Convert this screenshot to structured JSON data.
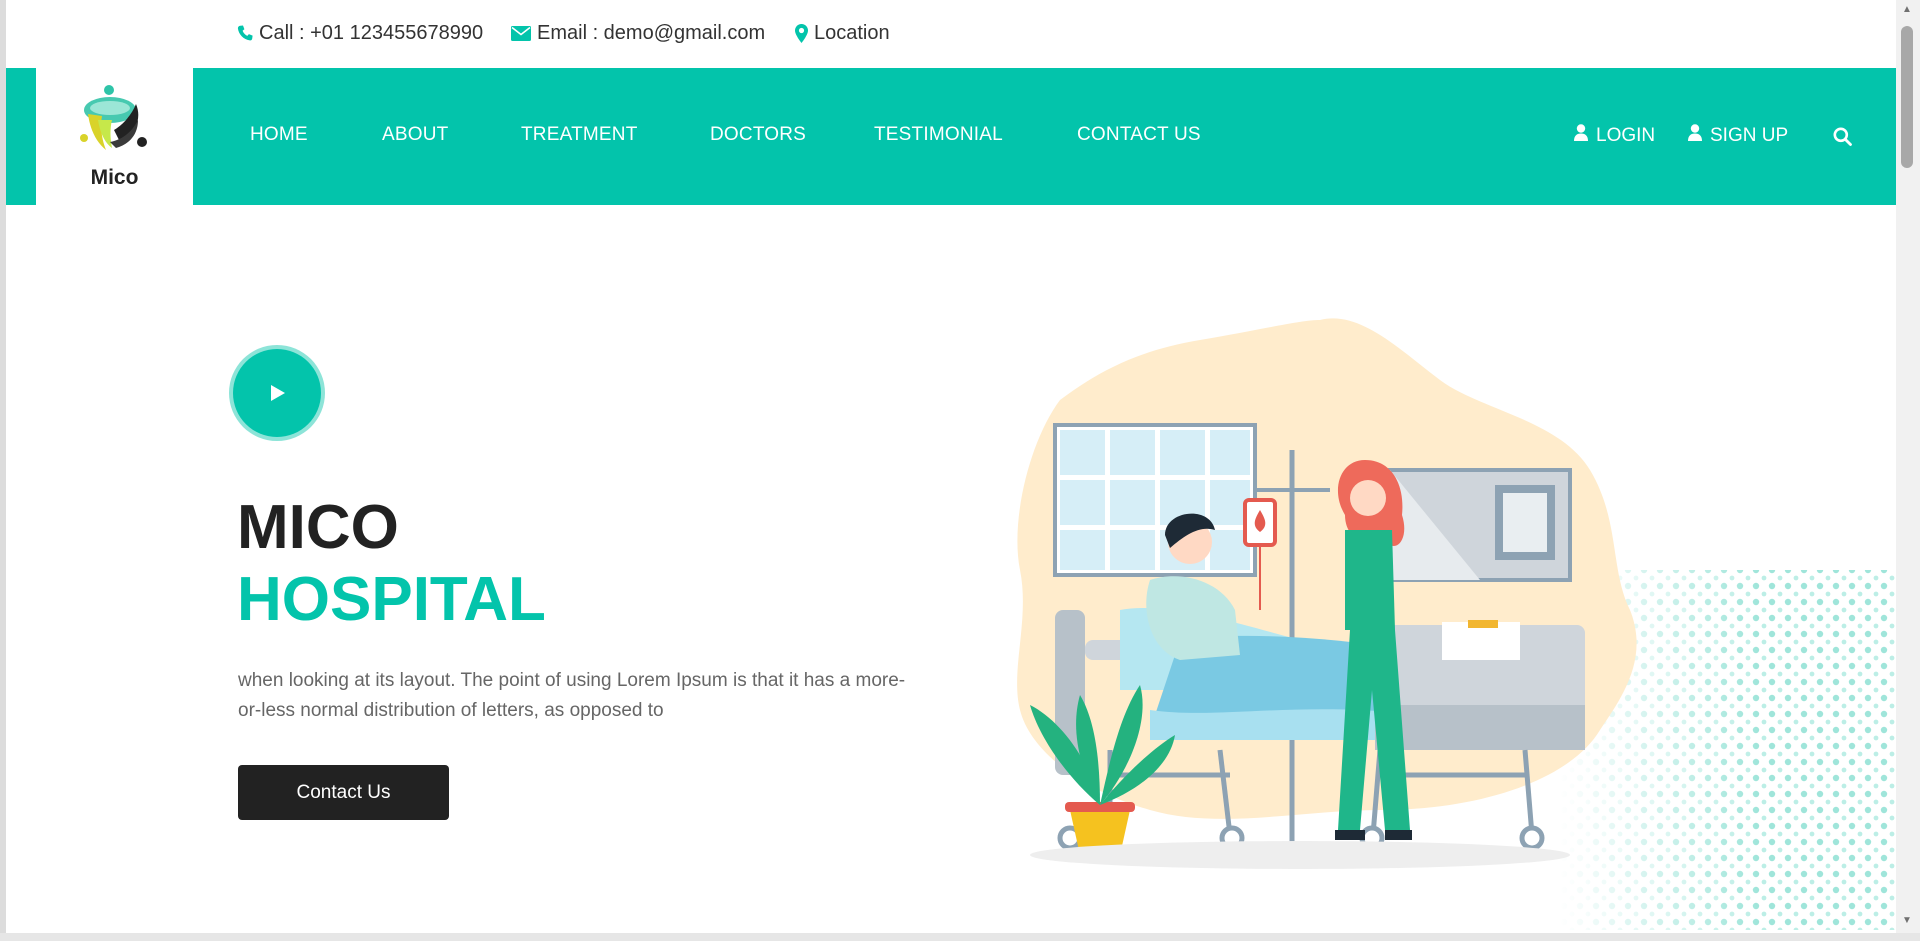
{
  "topbar": {
    "call": "Call : +01 123455678990",
    "email": "Email : demo@gmail.com",
    "location": "Location"
  },
  "brand": {
    "name": "Mico"
  },
  "nav": {
    "items": [
      "HOME",
      "ABOUT",
      "TREATMENT",
      "DOCTORS",
      "TESTIMONIAL",
      "CONTACT US"
    ],
    "login": "LOGIN",
    "signup": "SIGN UP"
  },
  "hero": {
    "title_line1": "MICO",
    "title_line2": "HOSPITAL",
    "description": "when looking at its layout. The point of using Lorem Ipsum is that it has a more-or-less normal distribution of letters, as opposed to",
    "cta": "Contact Us"
  },
  "colors": {
    "accent": "#03c4ab",
    "dark": "#222222",
    "text_muted": "#666666"
  },
  "icons": [
    "phone-icon",
    "envelope-icon",
    "map-marker-icon",
    "user-icon",
    "search-icon",
    "play-icon"
  ]
}
